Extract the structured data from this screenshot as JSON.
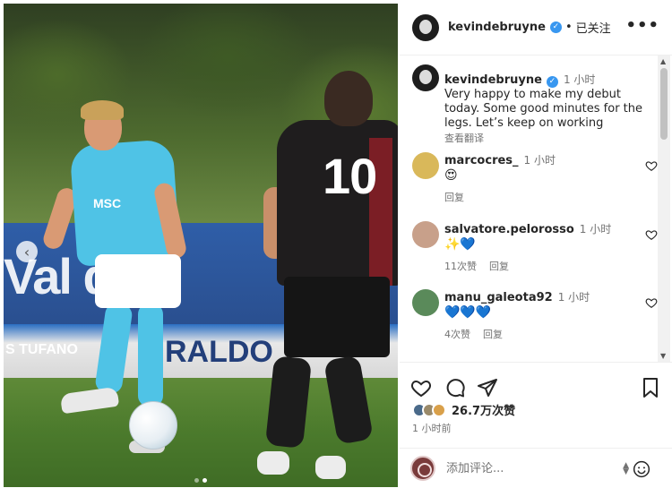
{
  "post": {
    "username": "kevindebruyne",
    "verified_mark": "✓",
    "separator": "•",
    "follow_label": "已关注",
    "more_label": "•••",
    "caption_time": "1 小时",
    "caption_text": "Very happy to make my debut today. Some good minutes for the legs. Let’s keep on working",
    "translate_label": "查看翻译"
  },
  "photo": {
    "banner_text_1": "Val di  le",
    "banner_text_2": "RALDO",
    "banner_text_3": "S TUFANO",
    "sponsor": "MSC",
    "jersey_number": "10",
    "prev_arrow": "‹"
  },
  "comments": [
    {
      "username": "marcocres_",
      "time": "1 小时",
      "emoji": "😍",
      "meta": [
        "回复"
      ],
      "avatar_color": "#d9b85a"
    },
    {
      "username": "salvatore.pelorosso",
      "time": "1 小时",
      "emoji": "✨💙",
      "meta": [
        "11次赞",
        "回复"
      ],
      "avatar_color": "#c8a08a"
    },
    {
      "username": "manu_galeota92",
      "time": "1 小时",
      "emoji": "💙💙💙",
      "meta": [
        "4次赞",
        "回复"
      ],
      "avatar_color": "#5a8a5a"
    }
  ],
  "likes": {
    "text": "26.7万次赞",
    "avatar_colors": [
      "#4a6a8a",
      "#9a8a6a",
      "#d9a04a"
    ]
  },
  "posted_time": "1 小时前",
  "add_comment": {
    "placeholder": "添加评论..."
  },
  "colors": {
    "verified": "#3897f0",
    "napoli_blue": "#4fc3e6"
  }
}
